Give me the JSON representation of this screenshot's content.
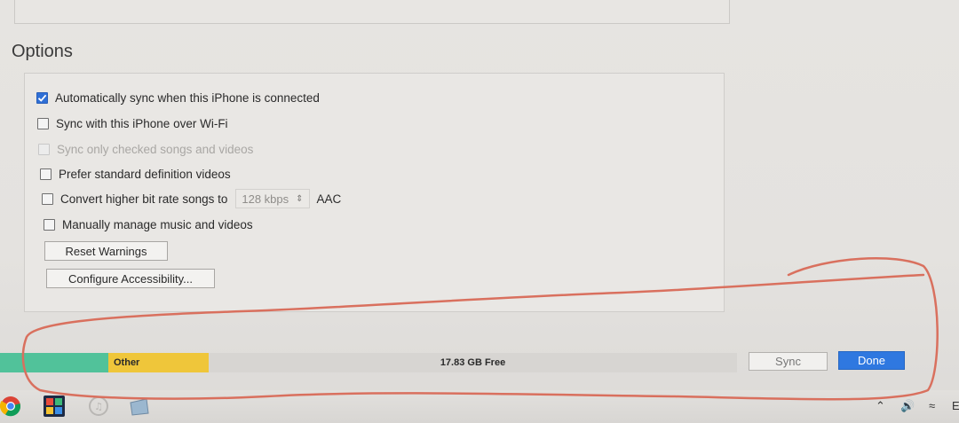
{
  "options": {
    "title": "Options",
    "items": [
      {
        "label": "Automatically sync when this iPhone is connected",
        "checked": true,
        "disabled": false
      },
      {
        "label": "Sync with this iPhone over Wi-Fi",
        "checked": false,
        "disabled": false
      },
      {
        "label": "Sync only checked songs and videos",
        "checked": false,
        "disabled": true
      },
      {
        "label": "Prefer standard definition videos",
        "checked": false,
        "disabled": false
      },
      {
        "label": "Convert higher bit rate songs to",
        "checked": false,
        "disabled": false
      },
      {
        "label": "Manually manage music and videos",
        "checked": false,
        "disabled": false
      }
    ],
    "bitrate_value": "128 kbps",
    "bitrate_format": "AAC",
    "reset_warnings_label": "Reset Warnings",
    "configure_accessibility_label": "Configure Accessibility..."
  },
  "storage": {
    "other_label": "Other",
    "free_label": "17.83 GB Free",
    "colors": {
      "apps": "#51c29a",
      "other": "#efc63a",
      "free": "#d7d5d2"
    }
  },
  "footer": {
    "sync_label": "Sync",
    "done_label": "Done",
    "accent": "#2f78e0"
  },
  "taskbar": {
    "icons": [
      "chrome-icon",
      "app-grid-icon",
      "itunes-icon",
      "files-icon"
    ],
    "tray_icons": [
      "chevron-up-icon",
      "volume-icon",
      "wifi-icon"
    ],
    "tray_text": "E"
  },
  "annotation": {
    "color": "#d9705e"
  }
}
